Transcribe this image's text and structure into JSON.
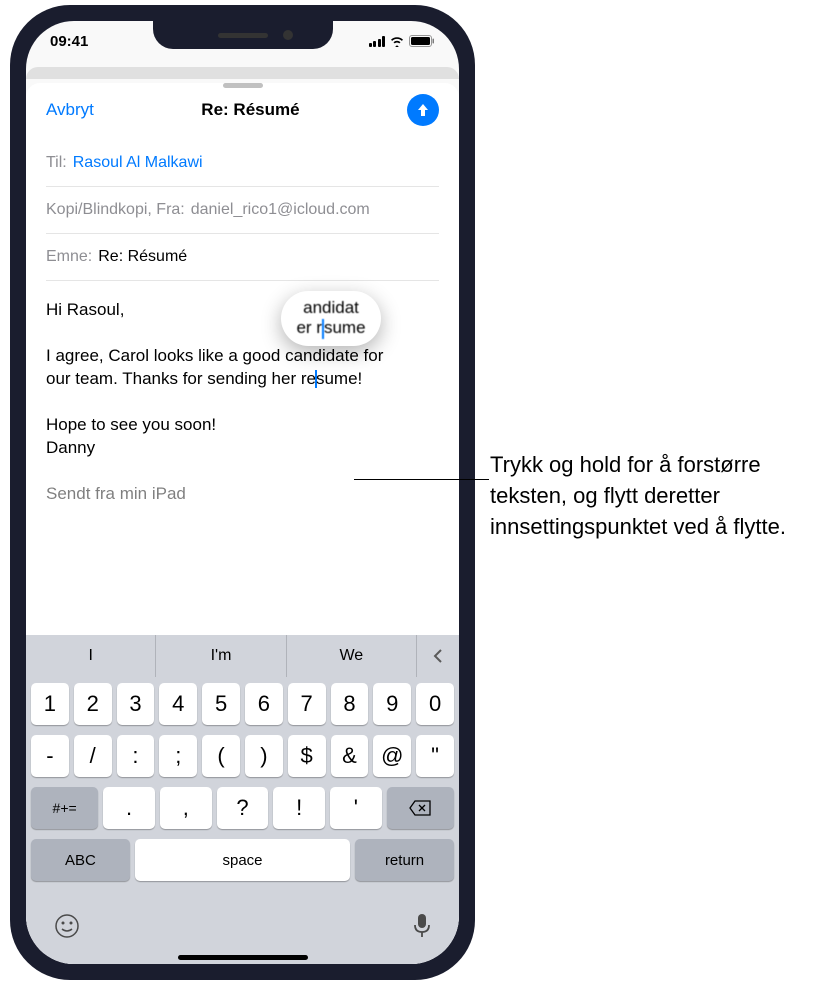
{
  "status_bar": {
    "time": "09:41"
  },
  "mail": {
    "cancel_label": "Avbryt",
    "title": "Re: Résumé",
    "to_label": "Til:",
    "to_value": "Rasoul Al Malkawi",
    "cc_label": "Kopi/Blindkopi, Fra:",
    "cc_value": "daniel_rico1@icloud.com",
    "subject_label": "Emne:",
    "subject_value": "Re: Résumé",
    "body_greeting": "Hi Rasoul,",
    "body_line1a": "I agree, Carol looks like a good candidate for",
    "body_line1b_before": "our team. Thanks for sending her r",
    "body_line1b_after": "sume!",
    "body_line2": "Hope to see you soon!",
    "body_sign": "Danny",
    "body_sent": "Sendt fra min iPad",
    "magnifier_line1": "andidat",
    "magnifier_line2a": "er r",
    "magnifier_line2b": "sume"
  },
  "keyboard": {
    "suggestions": [
      "I",
      "I'm",
      "We"
    ],
    "row1": [
      "1",
      "2",
      "3",
      "4",
      "5",
      "6",
      "7",
      "8",
      "9",
      "0"
    ],
    "row2": [
      "-",
      "/",
      ":",
      ";",
      "(",
      ")",
      "$",
      "&",
      "@",
      "\""
    ],
    "symbols_key": "#+=",
    "row3": [
      ".",
      ",",
      "?",
      "!",
      "'"
    ],
    "abc_key": "ABC",
    "space_key": "space",
    "return_key": "return"
  },
  "callout": {
    "text": "Trykk og hold for å forstørre teksten, og flytt deretter innsettingspunktet ved å flytte."
  }
}
